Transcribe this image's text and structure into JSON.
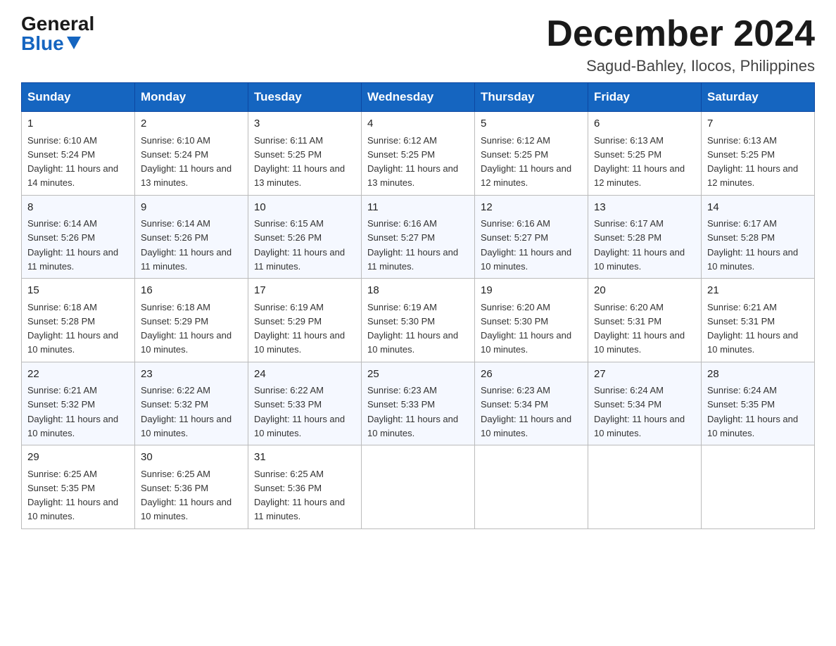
{
  "header": {
    "logo_general": "General",
    "logo_blue": "Blue",
    "month_title": "December 2024",
    "location": "Sagud-Bahley, Ilocos, Philippines"
  },
  "weekdays": [
    "Sunday",
    "Monday",
    "Tuesday",
    "Wednesday",
    "Thursday",
    "Friday",
    "Saturday"
  ],
  "weeks": [
    [
      {
        "day": "1",
        "sunrise": "6:10 AM",
        "sunset": "5:24 PM",
        "daylight": "11 hours and 14 minutes."
      },
      {
        "day": "2",
        "sunrise": "6:10 AM",
        "sunset": "5:24 PM",
        "daylight": "11 hours and 13 minutes."
      },
      {
        "day": "3",
        "sunrise": "6:11 AM",
        "sunset": "5:25 PM",
        "daylight": "11 hours and 13 minutes."
      },
      {
        "day": "4",
        "sunrise": "6:12 AM",
        "sunset": "5:25 PM",
        "daylight": "11 hours and 13 minutes."
      },
      {
        "day": "5",
        "sunrise": "6:12 AM",
        "sunset": "5:25 PM",
        "daylight": "11 hours and 12 minutes."
      },
      {
        "day": "6",
        "sunrise": "6:13 AM",
        "sunset": "5:25 PM",
        "daylight": "11 hours and 12 minutes."
      },
      {
        "day": "7",
        "sunrise": "6:13 AM",
        "sunset": "5:25 PM",
        "daylight": "11 hours and 12 minutes."
      }
    ],
    [
      {
        "day": "8",
        "sunrise": "6:14 AM",
        "sunset": "5:26 PM",
        "daylight": "11 hours and 11 minutes."
      },
      {
        "day": "9",
        "sunrise": "6:14 AM",
        "sunset": "5:26 PM",
        "daylight": "11 hours and 11 minutes."
      },
      {
        "day": "10",
        "sunrise": "6:15 AM",
        "sunset": "5:26 PM",
        "daylight": "11 hours and 11 minutes."
      },
      {
        "day": "11",
        "sunrise": "6:16 AM",
        "sunset": "5:27 PM",
        "daylight": "11 hours and 11 minutes."
      },
      {
        "day": "12",
        "sunrise": "6:16 AM",
        "sunset": "5:27 PM",
        "daylight": "11 hours and 10 minutes."
      },
      {
        "day": "13",
        "sunrise": "6:17 AM",
        "sunset": "5:28 PM",
        "daylight": "11 hours and 10 minutes."
      },
      {
        "day": "14",
        "sunrise": "6:17 AM",
        "sunset": "5:28 PM",
        "daylight": "11 hours and 10 minutes."
      }
    ],
    [
      {
        "day": "15",
        "sunrise": "6:18 AM",
        "sunset": "5:28 PM",
        "daylight": "11 hours and 10 minutes."
      },
      {
        "day": "16",
        "sunrise": "6:18 AM",
        "sunset": "5:29 PM",
        "daylight": "11 hours and 10 minutes."
      },
      {
        "day": "17",
        "sunrise": "6:19 AM",
        "sunset": "5:29 PM",
        "daylight": "11 hours and 10 minutes."
      },
      {
        "day": "18",
        "sunrise": "6:19 AM",
        "sunset": "5:30 PM",
        "daylight": "11 hours and 10 minutes."
      },
      {
        "day": "19",
        "sunrise": "6:20 AM",
        "sunset": "5:30 PM",
        "daylight": "11 hours and 10 minutes."
      },
      {
        "day": "20",
        "sunrise": "6:20 AM",
        "sunset": "5:31 PM",
        "daylight": "11 hours and 10 minutes."
      },
      {
        "day": "21",
        "sunrise": "6:21 AM",
        "sunset": "5:31 PM",
        "daylight": "11 hours and 10 minutes."
      }
    ],
    [
      {
        "day": "22",
        "sunrise": "6:21 AM",
        "sunset": "5:32 PM",
        "daylight": "11 hours and 10 minutes."
      },
      {
        "day": "23",
        "sunrise": "6:22 AM",
        "sunset": "5:32 PM",
        "daylight": "11 hours and 10 minutes."
      },
      {
        "day": "24",
        "sunrise": "6:22 AM",
        "sunset": "5:33 PM",
        "daylight": "11 hours and 10 minutes."
      },
      {
        "day": "25",
        "sunrise": "6:23 AM",
        "sunset": "5:33 PM",
        "daylight": "11 hours and 10 minutes."
      },
      {
        "day": "26",
        "sunrise": "6:23 AM",
        "sunset": "5:34 PM",
        "daylight": "11 hours and 10 minutes."
      },
      {
        "day": "27",
        "sunrise": "6:24 AM",
        "sunset": "5:34 PM",
        "daylight": "11 hours and 10 minutes."
      },
      {
        "day": "28",
        "sunrise": "6:24 AM",
        "sunset": "5:35 PM",
        "daylight": "11 hours and 10 minutes."
      }
    ],
    [
      {
        "day": "29",
        "sunrise": "6:25 AM",
        "sunset": "5:35 PM",
        "daylight": "11 hours and 10 minutes."
      },
      {
        "day": "30",
        "sunrise": "6:25 AM",
        "sunset": "5:36 PM",
        "daylight": "11 hours and 10 minutes."
      },
      {
        "day": "31",
        "sunrise": "6:25 AM",
        "sunset": "5:36 PM",
        "daylight": "11 hours and 11 minutes."
      },
      null,
      null,
      null,
      null
    ]
  ],
  "labels": {
    "sunrise_prefix": "Sunrise: ",
    "sunset_prefix": "Sunset: ",
    "daylight_prefix": "Daylight: "
  }
}
